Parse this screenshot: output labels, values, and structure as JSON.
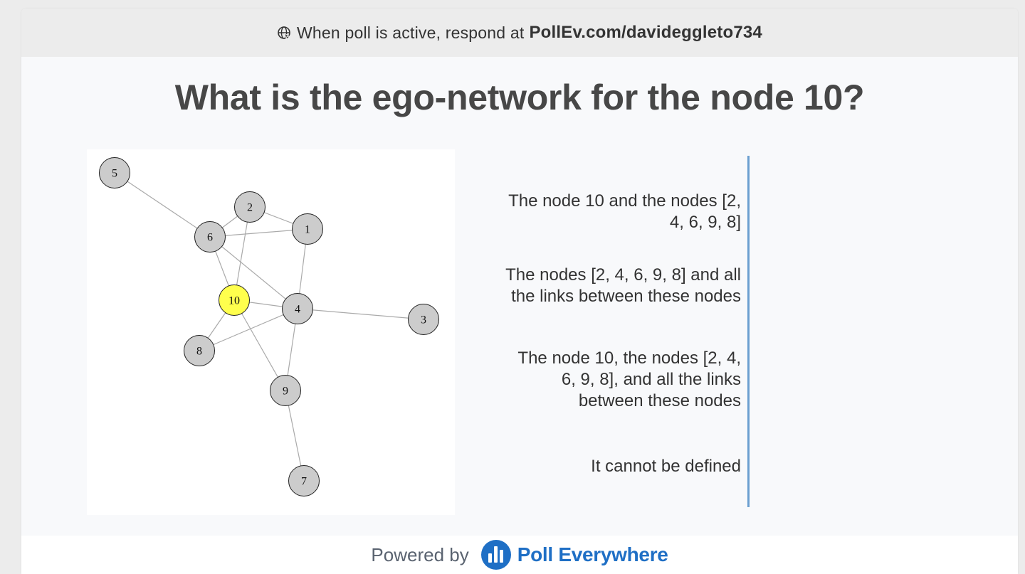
{
  "header": {
    "prefix": "When poll is active, respond at",
    "url": "PollEv.com/davideggleto734"
  },
  "question": {
    "title": "What is the ego-network for the node 10?"
  },
  "graph": {
    "highlight_color": "#ffff4d",
    "node_color": "#cccccc",
    "nodes": [
      {
        "id": "5"
      },
      {
        "id": "2"
      },
      {
        "id": "1"
      },
      {
        "id": "6"
      },
      {
        "id": "10"
      },
      {
        "id": "4"
      },
      {
        "id": "3"
      },
      {
        "id": "8"
      },
      {
        "id": "9"
      },
      {
        "id": "7"
      }
    ],
    "edges": [
      [
        "5",
        "6"
      ],
      [
        "2",
        "6"
      ],
      [
        "2",
        "1"
      ],
      [
        "6",
        "1"
      ],
      [
        "2",
        "10"
      ],
      [
        "1",
        "4"
      ],
      [
        "6",
        "10"
      ],
      [
        "6",
        "4"
      ],
      [
        "10",
        "4"
      ],
      [
        "4",
        "3"
      ],
      [
        "10",
        "8"
      ],
      [
        "8",
        "4"
      ],
      [
        "10",
        "9"
      ],
      [
        "4",
        "9"
      ],
      [
        "9",
        "7"
      ]
    ]
  },
  "options": [
    {
      "label": "The node 10 and the nodes [2, 4, 6, 9, 8]"
    },
    {
      "label": "The nodes [2, 4, 6, 9, 8] and all the links between these nodes"
    },
    {
      "label": "The node 10, the nodes [2, 4, 6, 9, 8], and all the links between these nodes"
    },
    {
      "label": "It cannot be defined"
    }
  ],
  "accent_color": "#6b9fd0",
  "footer": {
    "powered_by": "Powered by",
    "brand": "Poll Everywhere",
    "brand_color": "#1f6fc5"
  }
}
